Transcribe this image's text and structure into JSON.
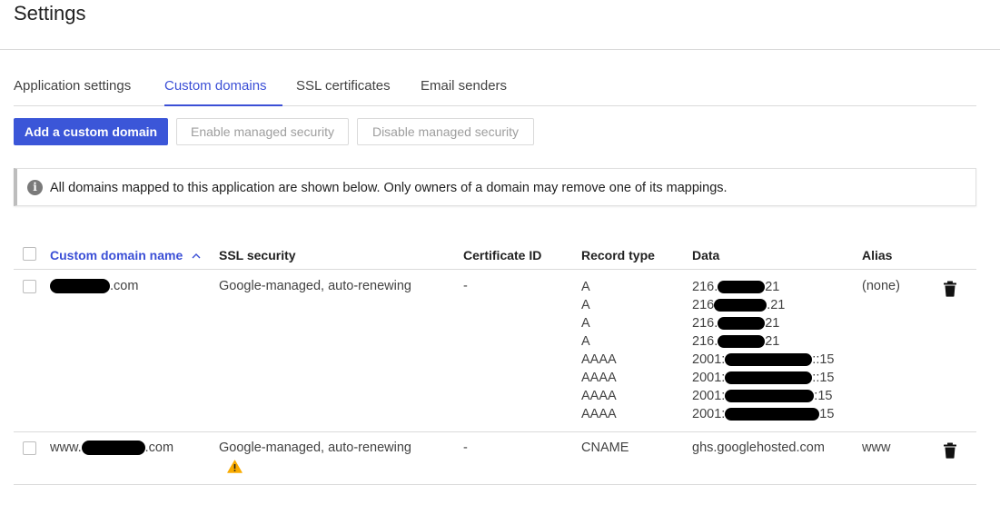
{
  "page": {
    "title": "Settings"
  },
  "tabs": [
    {
      "label": "Application settings",
      "active": false
    },
    {
      "label": "Custom domains",
      "active": true
    },
    {
      "label": "SSL certificates",
      "active": false
    },
    {
      "label": "Email senders",
      "active": false
    }
  ],
  "toolbar": {
    "add_label": "Add a custom domain",
    "enable_label": "Enable managed security",
    "disable_label": "Disable managed security"
  },
  "info": {
    "icon": "info-icon",
    "text": "All domains mapped to this application are shown below. Only owners of a domain may remove one of its mappings."
  },
  "table": {
    "headers": {
      "domain": "Custom domain name",
      "sort_indicator": "^",
      "ssl": "SSL security",
      "cert": "Certificate ID",
      "record_type": "Record type",
      "data": "Data",
      "alias": "Alias"
    },
    "rows": [
      {
        "domain_prefix": "",
        "domain_suffix": ".com",
        "ssl": "Google-managed, auto-renewing",
        "cert": "-",
        "record_types": [
          "A",
          "A",
          "A",
          "A",
          "AAAA",
          "AAAA",
          "AAAA",
          "AAAA"
        ],
        "data": [
          {
            "pre": "216.",
            "post": "21"
          },
          {
            "pre": "216",
            "post": ".21"
          },
          {
            "pre": "216.",
            "post": "21"
          },
          {
            "pre": "216.",
            "post": "21"
          },
          {
            "pre": "2001:",
            "post": "::15"
          },
          {
            "pre": "2001:",
            "post": "::15"
          },
          {
            "pre": "2001:",
            "post": ":15"
          },
          {
            "pre": "2001:",
            "post": "15"
          }
        ],
        "alias": "(none)",
        "warning": false
      },
      {
        "domain_prefix": "www.",
        "domain_suffix": ".com",
        "ssl": "Google-managed, auto-renewing",
        "cert": "-",
        "record_types": [
          "CNAME"
        ],
        "data_text": "ghs.googlehosted.com",
        "alias": "www",
        "warning": true
      }
    ]
  },
  "colors": {
    "accent": "#3b4fd6",
    "primary_button": "#3b56d8",
    "warning": "#f9ab00"
  }
}
